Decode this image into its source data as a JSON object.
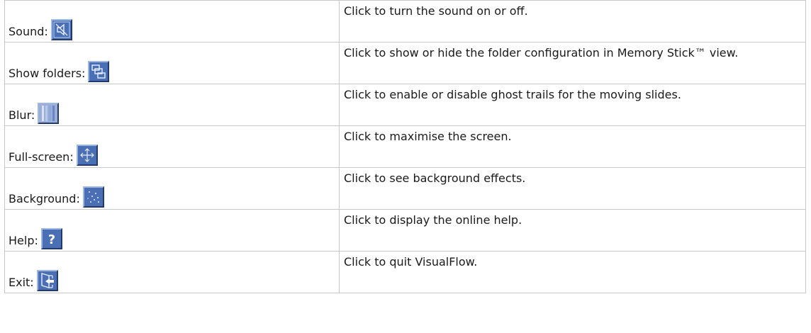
{
  "rows": [
    {
      "label": "Sound:",
      "icon": "speaker-muted-icon",
      "description": "Click to turn the sound on or off."
    },
    {
      "label": "Show folders:",
      "icon": "folders-icon",
      "description": "Click to show or hide the folder configuration in Memory Stick™ view."
    },
    {
      "label": "Blur:",
      "icon": "blur-icon",
      "description": "Click to enable or disable ghost trails for the moving slides."
    },
    {
      "label": "Full-screen:",
      "icon": "fullscreen-arrows-icon",
      "description": "Click to maximise the screen."
    },
    {
      "label": "Background:",
      "icon": "background-sparkle-icon",
      "description": "Click to see background effects."
    },
    {
      "label": "Help:",
      "icon": "help-question-icon",
      "description": "Click to display the online help."
    },
    {
      "label": "Exit:",
      "icon": "exit-door-icon",
      "description": "Click to quit VisualFlow."
    }
  ],
  "colors": {
    "icon_bg": "#4a6fb5",
    "border": "#c8c8c8"
  }
}
